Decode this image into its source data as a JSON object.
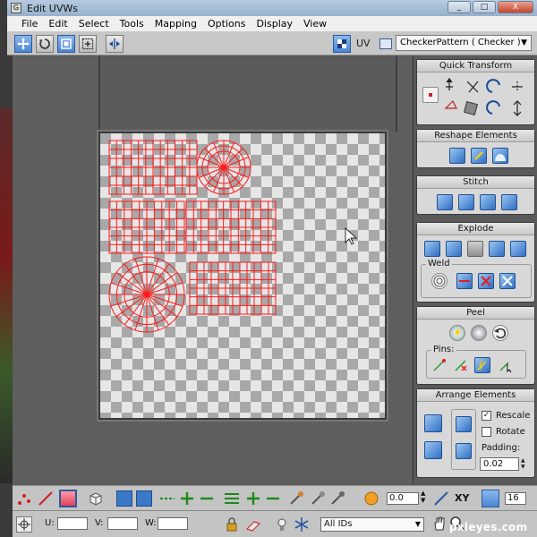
{
  "window": {
    "title": "Edit UVWs",
    "minimize": "_",
    "maximize": "□",
    "close": "X"
  },
  "menu": [
    "File",
    "Edit",
    "Select",
    "Tools",
    "Mapping",
    "Options",
    "Display",
    "View"
  ],
  "toolbar": {
    "uv_label": "UV",
    "map_select": "CheckerPattern  ( Checker )",
    "tools": [
      "move-tool",
      "rotate-tool",
      "scale-tool",
      "freeform-tool",
      "mirror-tool"
    ]
  },
  "panel": {
    "quick_transform": "Quick Transform",
    "reshape_elements": "Reshape Elements",
    "stitch": "Stitch",
    "explode": "Explode",
    "weld": "Weld",
    "peel": "Peel",
    "pins": "Pins:",
    "arrange_elements": "Arrange Elements",
    "rescale_label": "Rescale",
    "rescale_checked": true,
    "rotate_label": "Rotate",
    "rotate_checked": false,
    "padding_label": "Padding:",
    "padding_value": "0.02"
  },
  "bottom": {
    "soft_select_value": "0.0",
    "xy_label": "XY",
    "grid_value": "16",
    "u_label": "U:",
    "v_label": "V:",
    "w_label": "W:",
    "u_value": "",
    "v_value": "",
    "w_value": "",
    "id_select": "All IDs",
    "brightness_value": "0.0"
  },
  "watermark": "pxleyes.com",
  "colors": {
    "uv_wire": "#ff1a1a",
    "checker_light": "#e6e6e6",
    "checker_dark": "#a8a8a8",
    "accent_blue": "#2f6fc4"
  }
}
